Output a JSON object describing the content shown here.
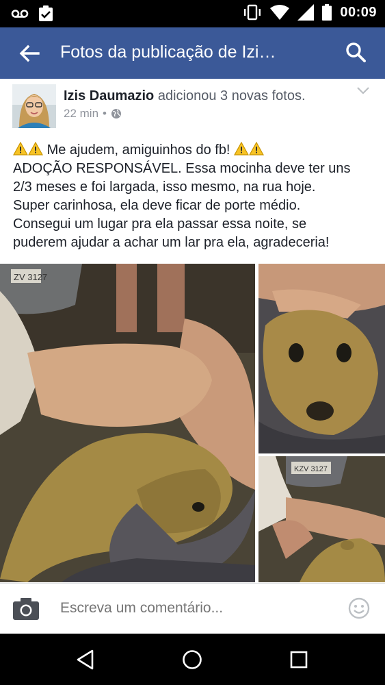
{
  "status_bar": {
    "time": "00:09",
    "icons": [
      "voicemail-icon",
      "clipboard-check-icon",
      "vibrate-icon",
      "wifi-icon",
      "signal-icon",
      "battery-icon"
    ]
  },
  "app_bar": {
    "title": "Fotos da publicação de Izi…",
    "icons": [
      "back-arrow-icon",
      "search-icon"
    ],
    "color": "#3b5998"
  },
  "post": {
    "author": "Izis Daumazio",
    "action": "adicionou 3 novas fotos.",
    "time": "22 min",
    "separator": "•",
    "privacy_icon": "globe-icon",
    "text_lines": [
      "Me ajudem, amiguinhos do fb!",
      "ADOÇÃO RESPONSÁVEL. Essa mocinha deve ter uns",
      "2/3 meses e foi largada, isso mesmo, na rua hoje.",
      "Super carinhosa, ela deve ficar de porte médio.",
      "Consegui um lugar pra ela passar essa noite, se",
      "puderem ajudar a achar um lar pra ela, agradeceria!"
    ],
    "photo_plate_1": "ZV 3127",
    "photo_plate_2": "KZV 3127"
  },
  "comment_bar": {
    "placeholder": "Escreva um comentário...",
    "icons": [
      "camera-icon",
      "smiley-icon"
    ]
  },
  "nav_bar": {
    "icons": [
      "back-triangle-icon",
      "home-circle-icon",
      "recents-square-icon"
    ]
  }
}
